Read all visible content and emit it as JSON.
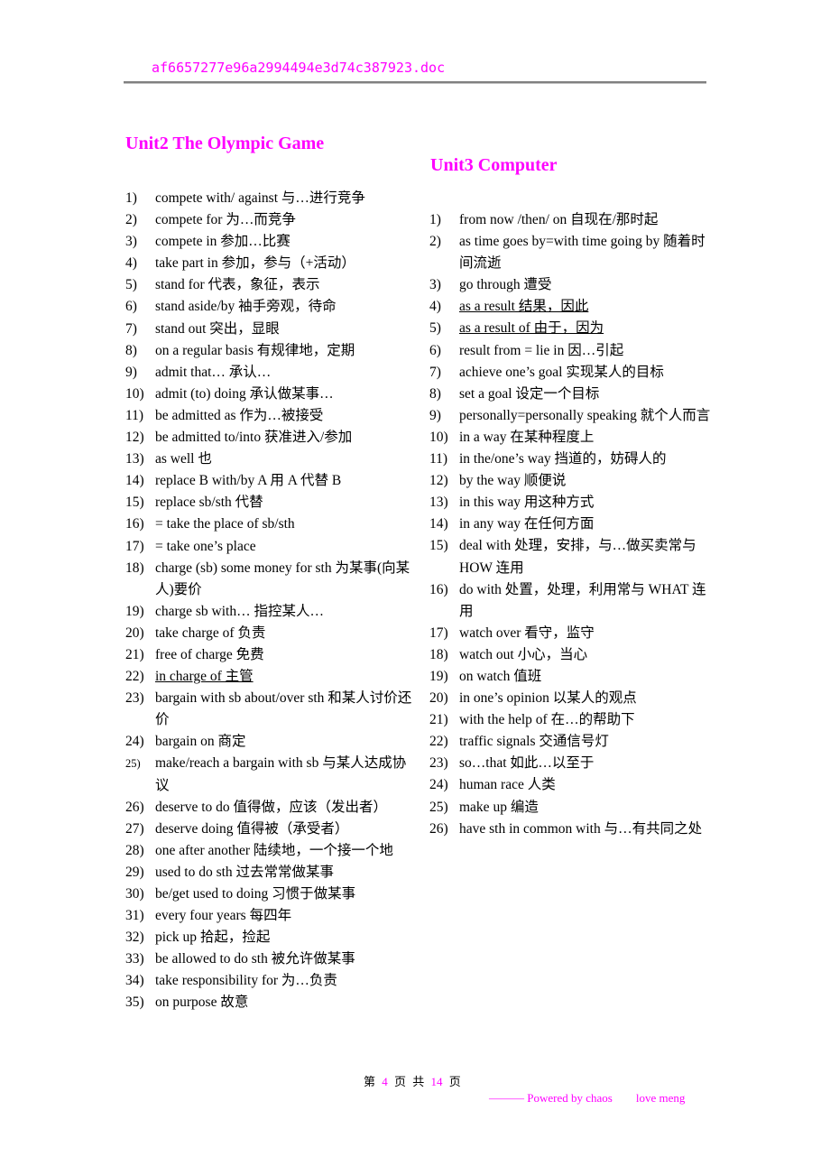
{
  "header": {
    "filename": "af6657277e96a2994494e3d74c387923.doc"
  },
  "unit2": {
    "title": "Unit2 The Olympic Game",
    "items": [
      {
        "n": "1)",
        "t": "compete with/ against  与…进行竞争"
      },
      {
        "n": "2)",
        "t": "compete for  为…而竞争"
      },
      {
        "n": "3)",
        "t": "compete in  参加…比赛"
      },
      {
        "n": "4)",
        "t": "take part in  参加，参与（+活动）"
      },
      {
        "n": "5)",
        "t": "stand for  代表，象征，表示"
      },
      {
        "n": "6)",
        "t": "stand aside/by  袖手旁观，待命"
      },
      {
        "n": "7)",
        "t": "stand out  突出，显眼"
      },
      {
        "n": "8)",
        "t": "on a regular basis  有规律地，定期"
      },
      {
        "n": "9)",
        "t": "admit that…  承认…"
      },
      {
        "n": "10)",
        "t": "admit (to) doing  承认做某事…"
      },
      {
        "n": "11)",
        "t": "be admitted as  作为…被接受"
      },
      {
        "n": "12)",
        "t": "be admitted to/into  获准进入/参加"
      },
      {
        "n": "13)",
        "t": "as well  也"
      },
      {
        "n": "14)",
        "t": "replace B with/by A    用 A 代替 B"
      },
      {
        "n": "15)",
        "t": "replace sb/sth  代替"
      },
      {
        "n": "16)",
        "t": "= take the place of sb/sth"
      },
      {
        "n": "17)",
        "t": "= take one’s place"
      },
      {
        "n": "18)",
        "t": "charge (sb) some money for sth 为某事(向某人)要价"
      },
      {
        "n": "19)",
        "t": "charge sb with…  指控某人…"
      },
      {
        "n": "20)",
        "t": "take charge of  负责"
      },
      {
        "n": "21)",
        "t": "free of charge  免费"
      },
      {
        "n": "22)",
        "t": "in charge of  主管",
        "underline": true
      },
      {
        "n": "23)",
        "t": "bargain with sb about/over sth 和某人讨价还价"
      },
      {
        "n": "24)",
        "t": "bargain on  商定"
      },
      {
        "n": "25)",
        "t": "make/reach a bargain with sb 与某人达成协议",
        "small": true
      },
      {
        "n": "26)",
        "t": "deserve to do  值得做，应该（发出者）"
      },
      {
        "n": "27)",
        "t": "deserve doing  值得被（承受者）"
      },
      {
        "n": "28)",
        "t": "one after another  陆续地，一个接一个地"
      },
      {
        "n": "29)",
        "t": "used to do sth  过去常常做某事"
      },
      {
        "n": "30)",
        "t": "be/get used to doing  习惯于做某事"
      },
      {
        "n": "31)",
        "t": "every four years  每四年"
      },
      {
        "n": "32)",
        "t": "pick up  拾起，捡起"
      },
      {
        "n": "33)",
        "t": "be allowed to do sth  被允许做某事"
      },
      {
        "n": "34)",
        "t": "take responsibility for  为…负责"
      },
      {
        "n": "35)",
        "t": "on purpose 故意"
      }
    ]
  },
  "unit3": {
    "title": "Unit3 Computer",
    "items": [
      {
        "n": "1)",
        "t": "from now /then/ on  自现在/那时起"
      },
      {
        "n": "2)",
        "t": "as time goes by=with time going by    随着时间流逝"
      },
      {
        "n": "3)",
        "t": "go through  遭受"
      },
      {
        "n": "4)",
        "t": "as a result  结果，因此",
        "underline": true
      },
      {
        "n": "5)",
        "t": "as a result of  由于，因为",
        "underline": true
      },
      {
        "n": "6)",
        "t": "result from = lie in  因…引起"
      },
      {
        "n": "7)",
        "t": "achieve one’s goal  实现某人的目标"
      },
      {
        "n": "8)",
        "t": "set a goal  设定一个目标"
      },
      {
        "n": "9)",
        "t": "personally=personally speaking  就个人而言"
      },
      {
        "n": "10)",
        "t": "in a way 在某种程度上"
      },
      {
        "n": "11)",
        "t": "in the/one’s way  挡道的，妨碍人的"
      },
      {
        "n": "12)",
        "t": "by the way  顺便说"
      },
      {
        "n": "13)",
        "t": "in this way  用这种方式"
      },
      {
        "n": "14)",
        "t": "in any way  在任何方面"
      },
      {
        "n": "15)",
        "t": "deal with  处理，安排，与…做买卖常与 HOW  连用"
      },
      {
        "n": "16)",
        "t": "do with  处置，处理，利用常与 WHAT 连用"
      },
      {
        "n": "17)",
        "t": "watch over  看守，监守"
      },
      {
        "n": "18)",
        "t": "watch out  小心，当心"
      },
      {
        "n": "19)",
        "t": "on watch  值班"
      },
      {
        "n": "20)",
        "t": "in one’s opinion  以某人的观点"
      },
      {
        "n": "21)",
        "t": "with the help of  在…的帮助下"
      },
      {
        "n": "22)",
        "t": "traffic signals  交通信号灯"
      },
      {
        "n": "23)",
        "t": "so…that  如此…以至于"
      },
      {
        "n": "24)",
        "t": "human race  人类"
      },
      {
        "n": "25)",
        "t": "make up  编造"
      },
      {
        "n": "26)",
        "t": "have sth in common with  与…有共同之处"
      }
    ]
  },
  "footer": {
    "page_prefix": "第",
    "page_current": "4",
    "page_mid": "页 共",
    "page_total": "14",
    "page_suffix": "页",
    "credit_left": "——— Powered by chaos",
    "credit_right": "love meng"
  }
}
